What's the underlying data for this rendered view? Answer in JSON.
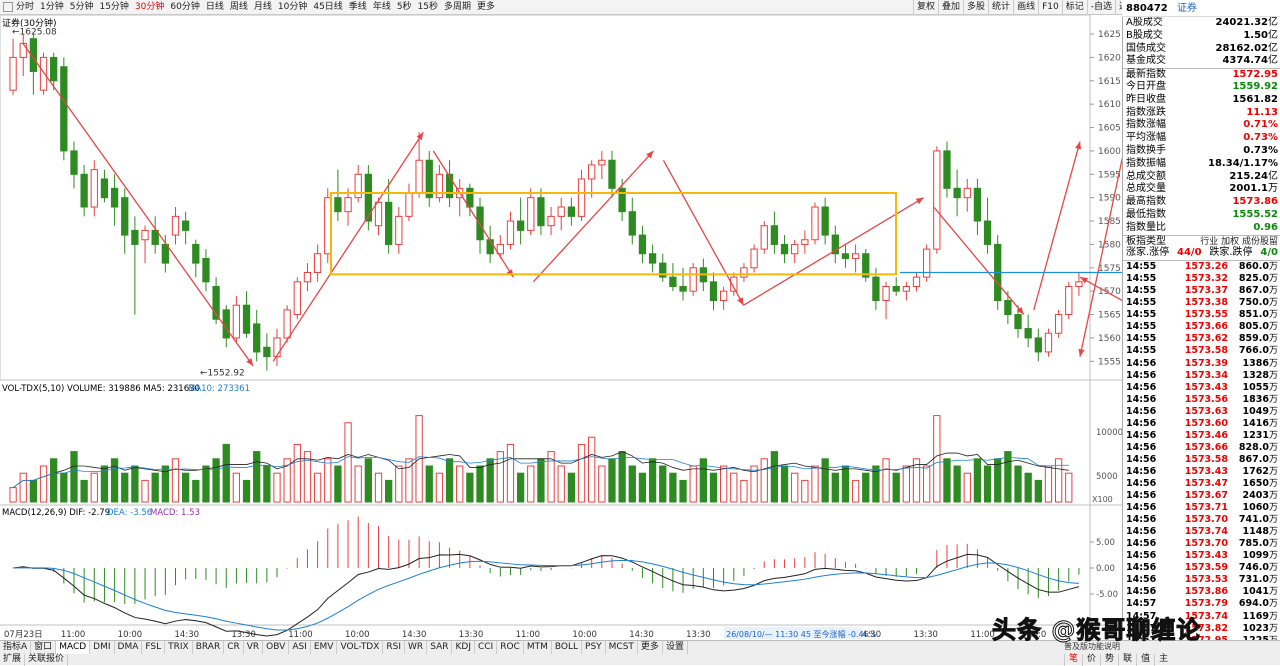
{
  "toolbar": {
    "periods": [
      "分时",
      "1分钟",
      "5分钟",
      "15分钟",
      "30分钟",
      "60分钟",
      "日线",
      "周线",
      "月线",
      "10分钟",
      "45日线",
      "季线",
      "年线",
      "5秒",
      "15秒",
      "多周期",
      "更多"
    ],
    "active_period": "30分钟",
    "tools": [
      "复权",
      "叠加",
      "多股",
      "统计",
      "画线",
      "F10",
      "标记",
      "-自选",
      "返回"
    ]
  },
  "quote_header": {
    "code": "880472",
    "name": "证券"
  },
  "stats": [
    {
      "k": "A股成交",
      "v": "24021.32",
      "u": "亿",
      "c": ""
    },
    {
      "k": "B股成交",
      "v": "1.50",
      "u": "亿",
      "c": ""
    },
    {
      "k": "国债成交",
      "v": "28162.02",
      "u": "亿",
      "c": ""
    },
    {
      "k": "基金成交",
      "v": "4374.74",
      "u": "亿",
      "c": ""
    },
    {
      "k": "最新指数",
      "v": "1572.95",
      "u": "",
      "c": "r",
      "sep": true
    },
    {
      "k": "今日开盘",
      "v": "1559.92",
      "u": "",
      "c": "g"
    },
    {
      "k": "昨日收盘",
      "v": "1561.82",
      "u": "",
      "c": ""
    },
    {
      "k": "指数涨跌",
      "v": "11.13",
      "u": "",
      "c": "r"
    },
    {
      "k": "指数涨幅",
      "v": "0.71%",
      "u": "",
      "c": "r"
    },
    {
      "k": "平均涨幅",
      "v": "0.73%",
      "u": "",
      "c": "r"
    },
    {
      "k": "指数换手",
      "v": "0.73%",
      "u": "",
      "c": ""
    },
    {
      "k": "指数振幅",
      "v": "18.34/1.17%",
      "u": "",
      "c": ""
    },
    {
      "k": "总成交额",
      "v": "215.24",
      "u": "亿",
      "c": ""
    },
    {
      "k": "总成交量",
      "v": "2001.1",
      "u": "万",
      "c": ""
    },
    {
      "k": "最高指数",
      "v": "1573.86",
      "u": "",
      "c": "r"
    },
    {
      "k": "最低指数",
      "v": "1555.52",
      "u": "",
      "c": "g"
    },
    {
      "k": "指数量比",
      "v": "0.96",
      "u": "",
      "c": "g"
    }
  ],
  "board_type": {
    "label": "板指类型",
    "value": "行业 加权 成份股留"
  },
  "updown": {
    "k1": "涨家.涨停",
    "v1": "44/0",
    "k2": "跌家.跌停",
    "v2": "4/0"
  },
  "ticks": [
    [
      "14:55",
      "1573.26",
      "860.0",
      "万"
    ],
    [
      "14:55",
      "1573.32",
      "825.0",
      "万"
    ],
    [
      "14:55",
      "1573.37",
      "867.0",
      "万"
    ],
    [
      "14:55",
      "1573.38",
      "750.0",
      "万"
    ],
    [
      "14:55",
      "1573.55",
      "851.0",
      "万"
    ],
    [
      "14:55",
      "1573.66",
      "805.0",
      "万"
    ],
    [
      "14:55",
      "1573.62",
      "859.0",
      "万"
    ],
    [
      "14:55",
      "1573.58",
      "766.0",
      "万"
    ],
    [
      "14:56",
      "1573.39",
      "1386",
      "万"
    ],
    [
      "14:56",
      "1573.34",
      "1328",
      "万"
    ],
    [
      "14:56",
      "1573.43",
      "1055",
      "万"
    ],
    [
      "14:56",
      "1573.56",
      "1836",
      "万"
    ],
    [
      "14:56",
      "1573.63",
      "1049",
      "万"
    ],
    [
      "14:56",
      "1573.60",
      "1416",
      "万"
    ],
    [
      "14:56",
      "1573.46",
      "1231",
      "万"
    ],
    [
      "14:56",
      "1573.66",
      "828.0",
      "万"
    ],
    [
      "14:56",
      "1573.58",
      "867.0",
      "万"
    ],
    [
      "14:56",
      "1573.43",
      "1762",
      "万"
    ],
    [
      "14:56",
      "1573.47",
      "1650",
      "万"
    ],
    [
      "14:56",
      "1573.67",
      "2403",
      "万"
    ],
    [
      "14:56",
      "1573.71",
      "1060",
      "万"
    ],
    [
      "14:56",
      "1573.70",
      "741.0",
      "万"
    ],
    [
      "14:56",
      "1573.74",
      "1148",
      "万"
    ],
    [
      "14:56",
      "1573.70",
      "785.0",
      "万"
    ],
    [
      "14:56",
      "1573.43",
      "1099",
      "万"
    ],
    [
      "14:56",
      "1573.59",
      "746.0",
      "万"
    ],
    [
      "14:56",
      "1573.53",
      "731.0",
      "万"
    ],
    [
      "14:56",
      "1573.86",
      "1041",
      "万"
    ],
    [
      "14:57",
      "1573.79",
      "694.0",
      "万"
    ],
    [
      "14:57",
      "1573.74",
      "1169",
      "万"
    ],
    [
      "14:57",
      "1573.82",
      "1023",
      "万"
    ],
    [
      "14:57",
      "1572.95",
      "1225",
      "万"
    ]
  ],
  "chart_data": {
    "type": "candlestick",
    "title": "证券(30分钟)",
    "price_axis": {
      "ticks": [
        1555,
        1560,
        1565,
        1570,
        1575,
        1580,
        1585,
        1590,
        1595,
        1600,
        1605,
        1610,
        1615,
        1620,
        1625
      ]
    },
    "annotations": {
      "high": "1625.08",
      "low": "1552.92"
    },
    "time_labels": [
      "07月23日",
      "11:00",
      "10:00",
      "14:30",
      "13:30",
      "11:00",
      "10:00",
      "14:30",
      "13:30",
      "11:00",
      "10:00",
      "14:30",
      "13:30",
      "11:00",
      "10:00",
      "14:30",
      "13:30",
      "11:00",
      "10:0"
    ],
    "status_note": "26/08/10/— 11:30 45 至今涨幅 -0.46%",
    "volume": {
      "label": "VOL-TDX(5,10)",
      "volume": "VOLUME: 319886",
      "ma5": "MA5: 231630",
      "ma10": "MA10: 273361",
      "ticks": [
        "10000",
        "5000"
      ],
      "unit": "X100"
    },
    "macd": {
      "label": "MACD(12,26,9)",
      "dif": "DIF: -2.79",
      "dea": "DEA: -3.56",
      "macd": "MACD: 1.53",
      "ticks": [
        "5.00",
        "0.00",
        "-5.00"
      ]
    },
    "colors": {
      "up": "#e84040",
      "down": "#2e8b22",
      "box": "#f5b80a",
      "hline": "#1e90d6",
      "dif": "#222",
      "dea": "#1e7fd6",
      "ma10": "#1e7fd6"
    },
    "candles_ohlc": [
      [
        1613,
        1624,
        1612,
        1620
      ],
      [
        1620,
        1625,
        1616,
        1623
      ],
      [
        1624,
        1625,
        1612,
        1617
      ],
      [
        1613,
        1621,
        1612,
        1620
      ],
      [
        1620,
        1621,
        1613,
        1615
      ],
      [
        1618,
        1620,
        1598,
        1600
      ],
      [
        1600,
        1602,
        1592,
        1595
      ],
      [
        1595,
        1597,
        1586,
        1588
      ],
      [
        1588,
        1598,
        1586,
        1596
      ],
      [
        1594,
        1596,
        1589,
        1590
      ],
      [
        1592,
        1595,
        1584,
        1588
      ],
      [
        1590,
        1592,
        1578,
        1582
      ],
      [
        1583,
        1586,
        1565,
        1580
      ],
      [
        1581,
        1584,
        1576,
        1583
      ],
      [
        1583,
        1586,
        1578,
        1580
      ],
      [
        1580,
        1582,
        1574,
        1576
      ],
      [
        1582,
        1588,
        1580,
        1586
      ],
      [
        1585,
        1587,
        1580,
        1583
      ],
      [
        1580,
        1581,
        1573,
        1576
      ],
      [
        1577,
        1579,
        1570,
        1572
      ],
      [
        1571,
        1573,
        1563,
        1564
      ],
      [
        1566,
        1567,
        1558,
        1560
      ],
      [
        1560,
        1569,
        1559,
        1567
      ],
      [
        1567,
        1570,
        1560,
        1561
      ],
      [
        1563,
        1566,
        1555,
        1557
      ],
      [
        1558,
        1561,
        1553,
        1556
      ],
      [
        1556,
        1562,
        1554,
        1560
      ],
      [
        1560,
        1567,
        1559,
        1566
      ],
      [
        1565,
        1573,
        1564,
        1572
      ],
      [
        1572,
        1576,
        1570,
        1574
      ],
      [
        1574,
        1580,
        1572,
        1578
      ],
      [
        1578,
        1592,
        1576,
        1590
      ],
      [
        1590,
        1596,
        1585,
        1587
      ],
      [
        1587,
        1592,
        1584,
        1590
      ],
      [
        1590,
        1597,
        1589,
        1595
      ],
      [
        1595,
        1597,
        1583,
        1585
      ],
      [
        1584,
        1590,
        1582,
        1589
      ],
      [
        1589,
        1594,
        1578,
        1580
      ],
      [
        1580,
        1588,
        1578,
        1586
      ],
      [
        1586,
        1593,
        1585,
        1591
      ],
      [
        1591,
        1604,
        1590,
        1598
      ],
      [
        1598,
        1600,
        1588,
        1590
      ],
      [
        1590,
        1597,
        1589,
        1595
      ],
      [
        1595,
        1598,
        1588,
        1590
      ],
      [
        1590,
        1594,
        1586,
        1592
      ],
      [
        1592,
        1593,
        1586,
        1588
      ],
      [
        1588,
        1590,
        1578,
        1581
      ],
      [
        1581,
        1584,
        1576,
        1578
      ],
      [
        1578,
        1582,
        1577,
        1580
      ],
      [
        1580,
        1587,
        1579,
        1585
      ],
      [
        1585,
        1590,
        1580,
        1583
      ],
      [
        1583,
        1592,
        1582,
        1590
      ],
      [
        1590,
        1592,
        1582,
        1584
      ],
      [
        1584,
        1588,
        1582,
        1586
      ],
      [
        1586,
        1590,
        1583,
        1588
      ],
      [
        1588,
        1590,
        1584,
        1586
      ],
      [
        1586,
        1596,
        1585,
        1594
      ],
      [
        1594,
        1598,
        1590,
        1597
      ],
      [
        1597,
        1600,
        1594,
        1598
      ],
      [
        1598,
        1600,
        1590,
        1592
      ],
      [
        1592,
        1594,
        1585,
        1587
      ],
      [
        1587,
        1590,
        1580,
        1582
      ],
      [
        1582,
        1584,
        1576,
        1578
      ],
      [
        1578,
        1580,
        1574,
        1576
      ],
      [
        1576,
        1578,
        1572,
        1573
      ],
      [
        1573,
        1576,
        1570,
        1571
      ],
      [
        1571,
        1575,
        1568,
        1570
      ],
      [
        1570,
        1576,
        1569,
        1575
      ],
      [
        1575,
        1577,
        1570,
        1572
      ],
      [
        1572,
        1574,
        1566,
        1568
      ],
      [
        1568,
        1571,
        1566,
        1570
      ],
      [
        1570,
        1574,
        1569,
        1573
      ],
      [
        1573,
        1576,
        1572,
        1575
      ],
      [
        1575,
        1580,
        1574,
        1579
      ],
      [
        1579,
        1585,
        1578,
        1584
      ],
      [
        1584,
        1587,
        1578,
        1580
      ],
      [
        1580,
        1582,
        1576,
        1578
      ],
      [
        1578,
        1581,
        1576,
        1580
      ],
      [
        1580,
        1583,
        1578,
        1581
      ],
      [
        1581,
        1589,
        1580,
        1588
      ],
      [
        1588,
        1590,
        1580,
        1582
      ],
      [
        1582,
        1584,
        1576,
        1578
      ],
      [
        1578,
        1580,
        1575,
        1577
      ],
      [
        1577,
        1580,
        1574,
        1578
      ],
      [
        1578,
        1579,
        1572,
        1573
      ],
      [
        1573,
        1575,
        1566,
        1568
      ],
      [
        1568,
        1572,
        1564,
        1571
      ],
      [
        1571,
        1573,
        1569,
        1570
      ],
      [
        1570,
        1572,
        1568,
        1571
      ],
      [
        1571,
        1574,
        1570,
        1573
      ],
      [
        1573,
        1580,
        1572,
        1579
      ],
      [
        1579,
        1601,
        1578,
        1600
      ],
      [
        1600,
        1602,
        1590,
        1592
      ],
      [
        1592,
        1596,
        1586,
        1590
      ],
      [
        1590,
        1594,
        1587,
        1592
      ],
      [
        1592,
        1594,
        1582,
        1585
      ],
      [
        1585,
        1590,
        1578,
        1580
      ],
      [
        1580,
        1582,
        1566,
        1568
      ],
      [
        1568,
        1570,
        1563,
        1565
      ],
      [
        1565,
        1567,
        1560,
        1562
      ],
      [
        1562,
        1565,
        1558,
        1560
      ],
      [
        1560,
        1562,
        1555,
        1557
      ],
      [
        1557,
        1562,
        1556,
        1561
      ],
      [
        1561,
        1566,
        1560,
        1565
      ],
      [
        1565,
        1572,
        1564,
        1571
      ],
      [
        1571,
        1574,
        1569,
        1572
      ]
    ],
    "volumes": [
      2,
      4,
      3,
      5,
      6,
      4,
      7,
      3,
      4,
      5,
      6,
      4,
      5,
      3,
      4,
      5,
      6,
      4,
      3,
      5,
      6,
      8,
      4,
      3,
      7,
      5,
      4,
      6,
      8,
      7,
      4,
      6,
      5,
      11,
      5,
      6,
      4,
      3,
      5,
      6,
      12,
      5,
      4,
      6,
      5,
      4,
      5,
      6,
      7,
      8,
      4,
      5,
      6,
      7,
      5,
      4,
      8,
      9,
      5,
      6,
      7,
      5,
      4,
      6,
      5,
      4,
      3,
      5,
      6,
      4,
      5,
      4,
      3,
      5,
      6,
      7,
      5,
      4,
      3,
      5,
      6,
      4,
      5,
      3,
      4,
      5,
      6,
      4,
      5,
      6,
      5,
      12,
      6,
      5,
      4,
      6,
      5,
      6,
      7,
      5,
      4,
      3,
      5,
      6,
      4
    ]
  },
  "bottom": {
    "tabs": [
      "指标A",
      "窗口",
      "MACD",
      "DMI",
      "DMA",
      "FSL",
      "TRIX",
      "BRAR",
      "CR",
      "VR",
      "OBV",
      "ASI",
      "EMV",
      "VOL-TDX",
      "RSI",
      "WR",
      "SAR",
      "KDJ",
      "CCI",
      "ROC",
      "MTM",
      "BOLL",
      "PSY",
      "MCST",
      "更多",
      "设置"
    ],
    "active_tab": "MACD",
    "row2": [
      "扩展",
      "关联报价"
    ],
    "tools": [
      "笔",
      "价",
      "势",
      "联",
      "值",
      "主"
    ],
    "active_tool": "笔",
    "note": "普及版功能说明",
    "right_tab": "指标B"
  },
  "watermark": "头条 @猴哥聊缠论"
}
